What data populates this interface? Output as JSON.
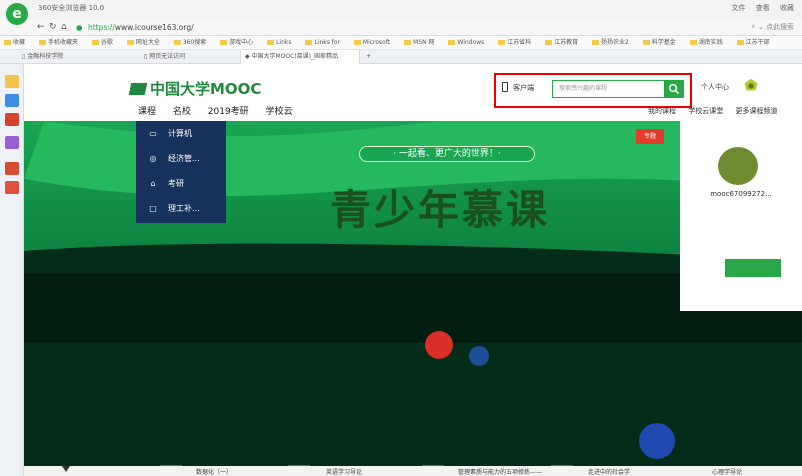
{
  "browser": {
    "title": "360安全浏览器 10.0",
    "url_protocol": "https://",
    "url_domain": "www.icourse163.org/",
    "menu": [
      "文件",
      "查看",
      "收藏"
    ],
    "search_placeholder": "点此搜索"
  },
  "bookmarks": [
    "收藏",
    "手机收藏夹",
    "谷歌",
    "网址大全",
    "360搜索",
    "游戏中心",
    "Links",
    "Links for",
    "Microsoft",
    "MSN 网",
    "Windows",
    "江苏省科",
    "江苏教育",
    "扬扬农业2",
    "科学基金",
    "湖南实践",
    "江苏干部"
  ],
  "tabs": [
    "金融科技学院",
    "网页无法访问",
    "中国大学MOOC(慕课)_国家精品"
  ],
  "site": {
    "logo": "中国大学MOOC",
    "nav": [
      "课程",
      "名校",
      "2019考研",
      "学校云"
    ],
    "client": "客户端",
    "search_placeholder": "搜索感兴趣的课程",
    "personal_center": "个人中心",
    "right_links": [
      "我的课程",
      "学校云课堂",
      "更多课程频道"
    ]
  },
  "categories": [
    {
      "icon": "▭",
      "label": "计算机"
    },
    {
      "icon": "◎",
      "label": "经济管..."
    },
    {
      "icon": "⌂",
      "label": "考研"
    },
    {
      "icon": "□",
      "label": "理工补..."
    }
  ],
  "banner": {
    "slogan": "· 一起看、更广大的世界！·",
    "title": "青少年慕课",
    "topic": "专题",
    "user_name": "mooc67099272..."
  },
  "bottom_items": [
    "数据化（一）",
    "英语学习导论",
    "管理素质与能力的五项修炼——",
    "走进中的社会学",
    "心理学导论"
  ],
  "colors": {
    "accent": "#2aa747",
    "banner": "#0d8a47",
    "menu": "#17335d",
    "highlight": "#e00000"
  }
}
